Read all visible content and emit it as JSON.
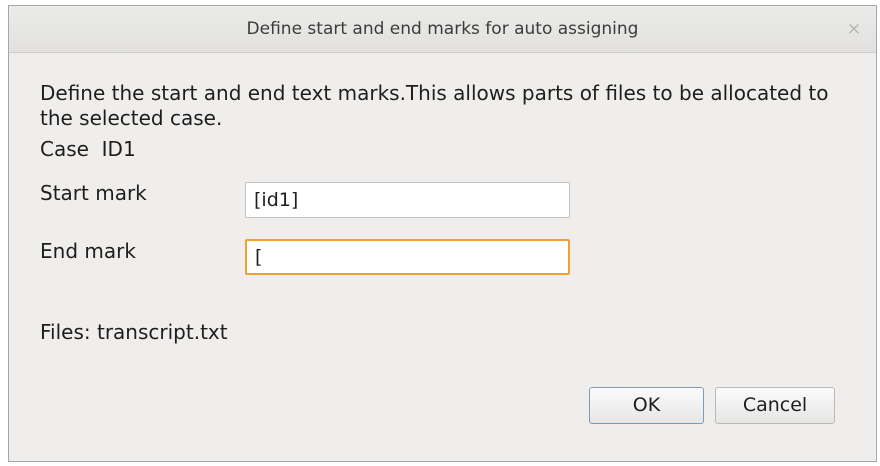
{
  "window": {
    "title": "Define start and end marks for auto assigning",
    "close_glyph": "×"
  },
  "content": {
    "description": "Define the start and end text marks.This allows parts of files to be allocated to the selected case.",
    "case_label": "Case  ID1",
    "start_mark_label": "Start mark",
    "start_mark_value": "[id1]",
    "end_mark_label": "End mark",
    "end_mark_value": "[",
    "files_text": "Files: transcript.txt"
  },
  "buttons": {
    "ok_label": "OK",
    "cancel_label": "Cancel"
  },
  "colors": {
    "focus_border": "#f0a230",
    "dialog_background": "#efeeec"
  }
}
